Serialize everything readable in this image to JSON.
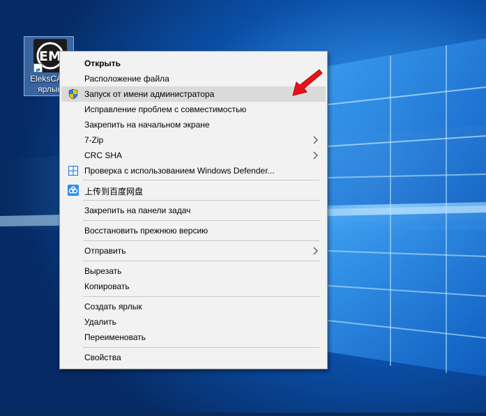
{
  "desktop": {
    "icon": {
      "label": "EleksCAM\nярлык",
      "label_line1": "EleksCAM",
      "label_line2": "ярлык",
      "glyph": "EM"
    },
    "accent": "#0078d7"
  },
  "context_menu": {
    "items": [
      {
        "label": "Открыть",
        "icon": ""
      },
      {
        "label": "Расположение файла",
        "icon": ""
      },
      {
        "label": "Запуск от имени администратора",
        "icon": "uac-shield-icon"
      },
      {
        "label": "Исправление проблем с совместимостью",
        "icon": ""
      },
      {
        "label": "Закрепить на начальном экране",
        "icon": ""
      },
      {
        "label": "7-Zip",
        "icon": "",
        "submenu": true
      },
      {
        "label": "CRC SHA",
        "icon": "",
        "submenu": true
      },
      {
        "label": "Проверка с использованием Windows Defender...",
        "icon": "windows-defender-icon"
      },
      {
        "label": "上传到百度网盘",
        "icon": "baidu-netdisk-icon"
      },
      {
        "label": "Закрепить на панели задач",
        "icon": ""
      },
      {
        "label": "Восстановить прежнюю версию",
        "icon": ""
      },
      {
        "label": "Отправить",
        "icon": "",
        "submenu": true
      },
      {
        "label": "Вырезать",
        "icon": ""
      },
      {
        "label": "Копировать",
        "icon": ""
      },
      {
        "label": "Создать ярлык",
        "icon": ""
      },
      {
        "label": "Удалить",
        "icon": ""
      },
      {
        "label": "Переименовать",
        "icon": ""
      },
      {
        "label": "Свойства",
        "icon": ""
      }
    ],
    "highlighted_item": "Запуск от имени администратора",
    "highlight_color": "#dadada",
    "annotation_color": "#e8131a"
  }
}
